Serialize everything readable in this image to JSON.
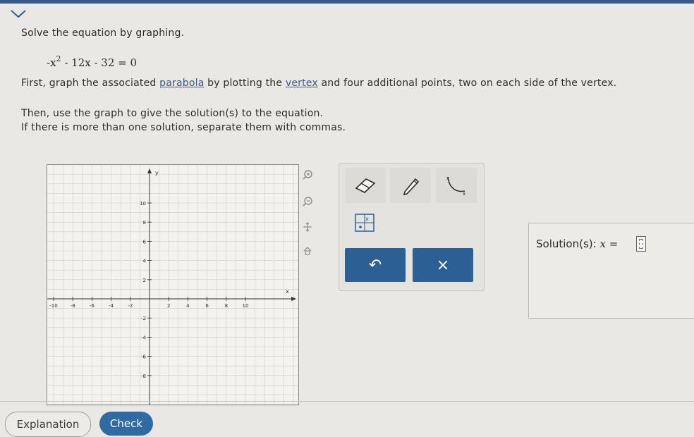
{
  "question": {
    "instruction": "Solve the equation by graphing.",
    "equation": {
      "lead": "-x",
      "exponent": "2",
      "rest": "- 12x - 32 = 0"
    },
    "step1_before": "First, graph the associated ",
    "step1_link1": "parabola",
    "step1_middle": " by plotting the ",
    "step1_link2": "vertex",
    "step1_after": " and four additional points, two on each side of the vertex.",
    "step2": "Then, use the graph to give the solution(s) to the equation.",
    "step3": "If there is more than one solution, separate them with commas."
  },
  "graph": {
    "x_label": "x",
    "y_label": "y",
    "x_tick_labels": [
      "-10",
      "-8",
      "-6",
      "-4",
      "-2",
      "2",
      "4",
      "6",
      "8",
      "10"
    ],
    "y_tick_labels": [
      "10",
      "8",
      "6",
      "4",
      "2",
      "-2",
      "-4",
      "-6",
      "-8"
    ]
  },
  "side_tools": [
    "zoom-in-icon",
    "zoom-out-icon",
    "move-icon",
    "home-icon"
  ],
  "palette": {
    "tools": [
      "eraser-icon",
      "pencil-icon",
      "parabola-tool-icon",
      "point-tool-icon"
    ],
    "undo_symbol": "↶",
    "clear_symbol": "×"
  },
  "solution": {
    "label": "Solution(s):",
    "var": "x ="
  },
  "buttons": {
    "explanation": "Explanation",
    "check": "Check"
  },
  "colors": {
    "accent": "#2c5f93",
    "link": "#2f5b8c"
  }
}
